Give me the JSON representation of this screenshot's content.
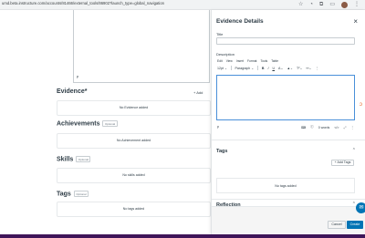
{
  "browser": {
    "url": "umd.beta.instructure.com/accounts/81466/external_tools/86902?launch_type=global_navigation"
  },
  "left_page": {
    "editor_path": "p",
    "sections": [
      {
        "title": "Evidence",
        "required_mark": "*",
        "action": "+ Add",
        "empty_text": "No Evidence added"
      },
      {
        "title": "Achievements",
        "badge": "Optional",
        "empty_text": "No Achievement added"
      },
      {
        "title": "Skills",
        "badge": "Optional",
        "empty_text": "No skills added"
      },
      {
        "title": "Tags",
        "badge": "Optional",
        "empty_text": "No tags added"
      }
    ]
  },
  "drawer": {
    "title": "Evidence Details",
    "title_label": "Title",
    "title_value": "",
    "description_label": "Description",
    "menu": [
      "Edit",
      "View",
      "Insert",
      "Format",
      "Tools",
      "Table"
    ],
    "toolbar": {
      "font_size": "12pt",
      "block_format": "Paragraph",
      "bold": "B",
      "italic": "I",
      "underline": "U"
    },
    "editor_path": "p",
    "word_count": "0 words",
    "html_toggle": "</>",
    "tags_title": "Tags",
    "add_tag_label": "+ Add Tags",
    "no_tags_text": "No tags added",
    "reflection_title": "Reflection",
    "cancel_label": "Cancel",
    "create_label": "Create"
  },
  "colors": {
    "primary": "#0374b5",
    "bottom_band": "#3f1559",
    "accent_orange": "#e8672a"
  }
}
